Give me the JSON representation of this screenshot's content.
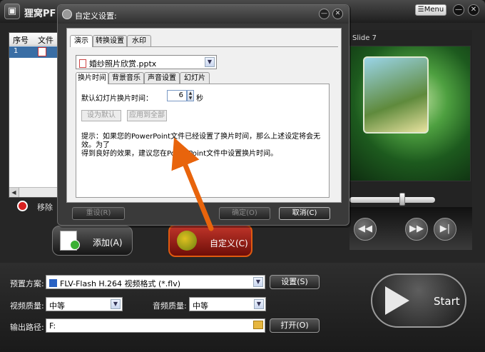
{
  "app": {
    "title": "狸窝PF",
    "logo_glyph": "▣",
    "menu_label": "Menu",
    "menu_icon_glyph": "☰",
    "min_glyph": "—",
    "close_glyph": "✕"
  },
  "file_list": {
    "col_num": "序号",
    "col_file": "文件",
    "rows": [
      {
        "num": "1"
      }
    ],
    "scroll_left_glyph": "◀"
  },
  "remove": {
    "label": "移除"
  },
  "preview": {
    "slide_label": "Slide 7",
    "prev_glyph": "◀◀",
    "next_glyph": "▶▶",
    "end_glyph": "▶|",
    "progress": 0.62
  },
  "add_button": {
    "label": "添加(A)"
  },
  "custom_button": {
    "label": "自定义(C)"
  },
  "bottom": {
    "preset_label": "预置方案:",
    "preset_value": "FLV-Flash H.264 视频格式 (*.flv)",
    "settings_label": "设置(S)",
    "video_quality_label": "视频质量:",
    "video_quality_value": "中等",
    "audio_quality_label": "音频质量:",
    "audio_quality_value": "中等",
    "output_label": "输出路径:",
    "output_value": "F:",
    "open_label": "打开(O)",
    "start_label": "Start",
    "dropdown_glyph": "▼"
  },
  "dialog": {
    "title": "自定义设置:",
    "min_glyph": "—",
    "close_glyph": "✕",
    "tabs": [
      "演示",
      "转换设置",
      "水印"
    ],
    "file_value": "婚纱照片欣赏.pptx",
    "sub_tabs": [
      "换片时间",
      "背景音乐",
      "声音设置",
      "幻灯片"
    ],
    "interval_label": "默认幻灯片换片时间：",
    "interval_value": "6",
    "interval_unit": "秒",
    "spin_up": "▲",
    "spin_down": "▼",
    "set_default_label": "设为默认",
    "apply_all_label": "应用到全部",
    "hint_line1": "提示：如果您的PowerPoint文件已经设置了换片时间，那么上述设定将会无效。为了",
    "hint_line2": "得到良好的效果，建议您在PowerPoint文件中设置换片时间。",
    "reset_label": "重设(R)",
    "ok_label": "确定(O)",
    "cancel_label": "取消(C)"
  },
  "colors": {
    "highlight": "#e8640c",
    "accent_red": "#c0352a",
    "row_selected": "#3a6ea5"
  }
}
